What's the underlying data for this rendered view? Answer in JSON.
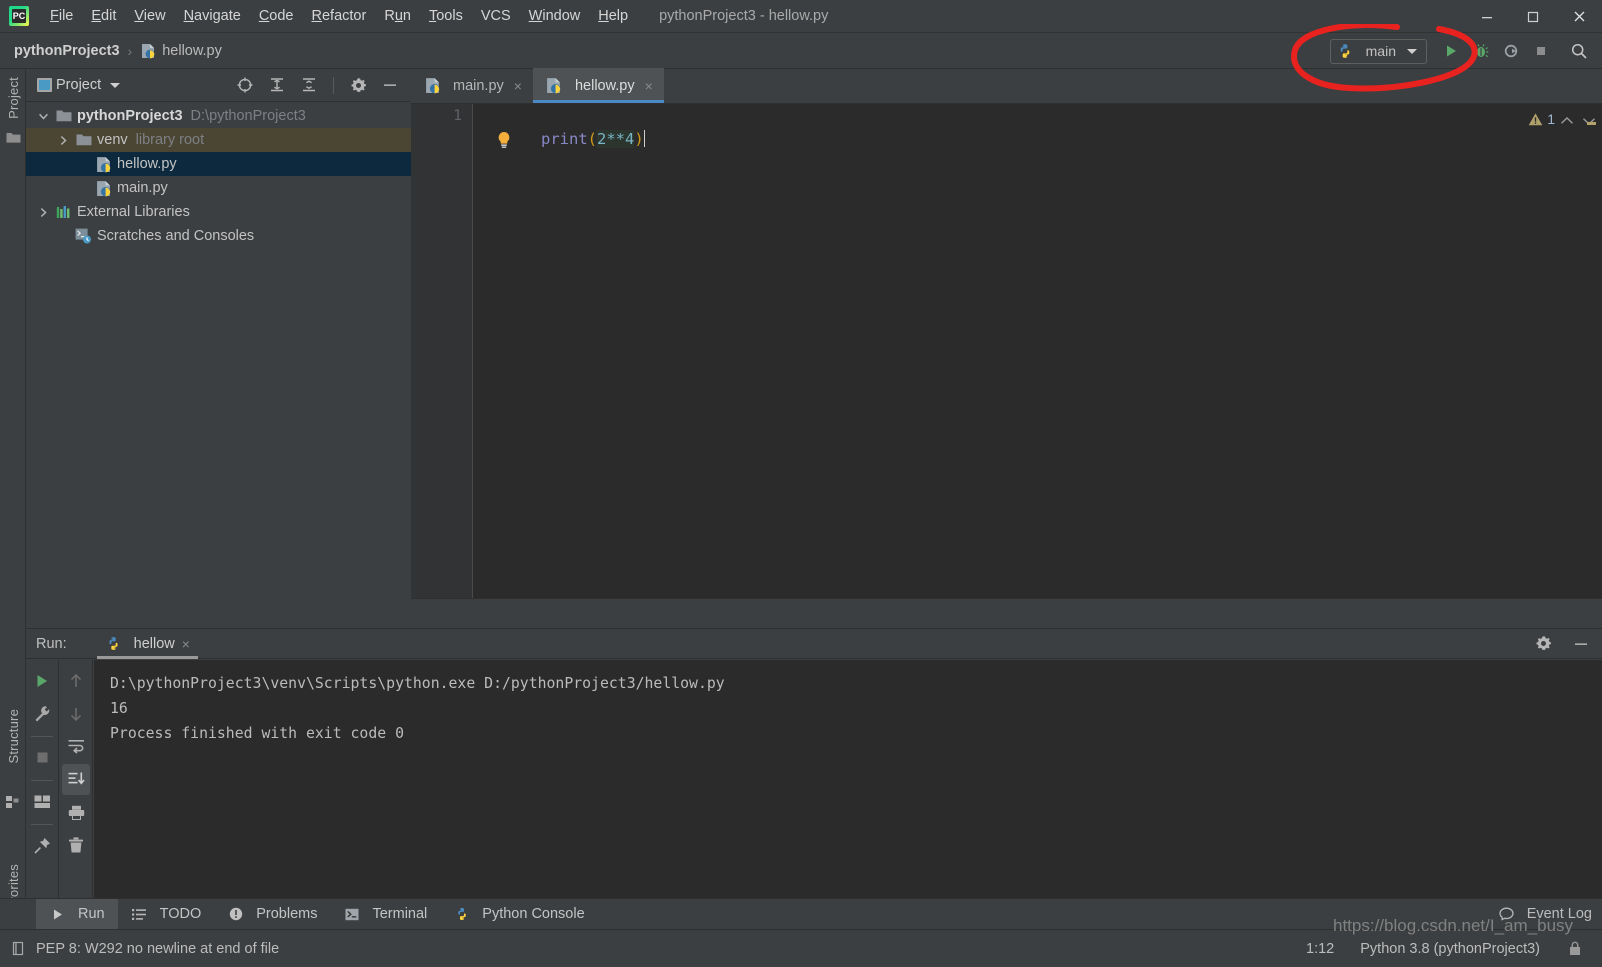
{
  "app": {
    "logo_text": "PC",
    "window_title": "pythonProject3 - hellow.py"
  },
  "menubar": {
    "items": [
      {
        "label": "File",
        "mnemonic": "F"
      },
      {
        "label": "Edit",
        "mnemonic": "E"
      },
      {
        "label": "View",
        "mnemonic": "V"
      },
      {
        "label": "Navigate",
        "mnemonic": "N"
      },
      {
        "label": "Code",
        "mnemonic": "C"
      },
      {
        "label": "Refactor",
        "mnemonic": "R"
      },
      {
        "label": "Run",
        "mnemonic": "u"
      },
      {
        "label": "Tools",
        "mnemonic": "T"
      },
      {
        "label": "VCS",
        "mnemonic": ""
      },
      {
        "label": "Window",
        "mnemonic": "W"
      },
      {
        "label": "Help",
        "mnemonic": "H"
      }
    ]
  },
  "window_controls": {
    "minimize": "minimize-icon",
    "maximize": "maximize-icon",
    "close": "close-icon"
  },
  "navbar": {
    "breadcrumb": [
      {
        "label": "pythonProject3",
        "icon": ""
      },
      {
        "label": "hellow.py",
        "icon": "python-file-icon"
      }
    ],
    "separator": "›",
    "run_config": {
      "name": "main",
      "icon": "python-icon",
      "dropdown": "chevron-down-icon"
    },
    "actions": [
      {
        "name": "run-button",
        "icon": "play-icon",
        "color": "#59a869"
      },
      {
        "name": "debug-button",
        "icon": "bug-icon",
        "color": "#59a869"
      },
      {
        "name": "run-coverage-button",
        "icon": "coverage-icon",
        "color": "#a6a6a6"
      },
      {
        "name": "stop-button",
        "icon": "stop-icon",
        "color": "#8c8c8c"
      },
      {
        "name": "search-everywhere-button",
        "icon": "search-icon",
        "color": "#c0c0c0"
      }
    ]
  },
  "annotation": {
    "shape": "hand-drawn-red-circle",
    "color": "#e8231f"
  },
  "left_strip": {
    "top_label": "Project",
    "top_icon": "folder-icon",
    "structure_label": "Structure",
    "structure_icon": "structure-icon",
    "favorites_label": "Favorites",
    "favorites_icon": "star-icon"
  },
  "project_panel": {
    "title": "Project",
    "dropdown": "chevron-down-icon",
    "toolbar": [
      {
        "name": "select-opened-file-button",
        "icon": "target-icon"
      },
      {
        "name": "expand-all-button",
        "icon": "expand-all-icon"
      },
      {
        "name": "collapse-all-button",
        "icon": "collapse-all-icon"
      },
      {
        "name": "settings-button",
        "icon": "gear-icon"
      },
      {
        "name": "hide-button",
        "icon": "minus-icon"
      }
    ],
    "tree": [
      {
        "label": "pythonProject3",
        "sub": "D:\\pythonProject3",
        "icon": "folder-icon",
        "arrow": "chevron-expanded",
        "indent": 0,
        "bold": true,
        "state": "normal"
      },
      {
        "label": "venv",
        "sub": "library root",
        "icon": "folder-icon",
        "arrow": "chevron-collapsed",
        "indent": 1,
        "bold": false,
        "state": "highlighted"
      },
      {
        "label": "hellow.py",
        "sub": "",
        "icon": "python-file-icon",
        "arrow": "none",
        "indent": 2,
        "bold": false,
        "state": "selected"
      },
      {
        "label": "main.py",
        "sub": "",
        "icon": "python-file-icon",
        "arrow": "none",
        "indent": 2,
        "bold": false,
        "state": "normal"
      },
      {
        "label": "External Libraries",
        "sub": "",
        "icon": "library-icon",
        "arrow": "chevron-collapsed",
        "indent": 0,
        "bold": false,
        "state": "normal"
      },
      {
        "label": "Scratches and Consoles",
        "sub": "",
        "icon": "scratches-icon",
        "arrow": "none",
        "indent": 1,
        "bold": false,
        "state": "normal"
      }
    ]
  },
  "editor": {
    "tabs": [
      {
        "label": "main.py",
        "icon": "python-file-icon",
        "active": false,
        "close": "×"
      },
      {
        "label": "hellow.py",
        "icon": "python-file-icon",
        "active": true,
        "close": "×"
      }
    ],
    "line_numbers": [
      "1"
    ],
    "code_tokens": [
      {
        "text": "print",
        "kind": "function"
      },
      {
        "text": "(",
        "kind": "paren"
      },
      {
        "text": "2**4",
        "kind": "number"
      },
      {
        "text": ")",
        "kind": "paren"
      }
    ],
    "code_plain": "print(2**4)",
    "intention_bulb": "lightbulb-icon",
    "inspection": {
      "icon": "warning-icon",
      "count": "1",
      "prev": "chevron-up-icon",
      "next": "chevron-down-icon"
    }
  },
  "run_panel": {
    "label": "Run:",
    "tab_name": "hellow",
    "tab_icon": "python-icon",
    "tab_close": "×",
    "header_actions": [
      {
        "name": "run-settings-button",
        "icon": "gear-icon"
      },
      {
        "name": "hide-run-panel-button",
        "icon": "minus-icon"
      }
    ],
    "toolbar_left": [
      {
        "name": "rerun-button",
        "icon": "play-icon",
        "color": "#59a869",
        "active": false
      },
      {
        "name": "edit-configuration-button",
        "icon": "wrench-icon",
        "color": "#a9a9a9",
        "active": false
      },
      {
        "name": "stop-button",
        "icon": "stop-icon",
        "color": "#8a8a8a",
        "active": false
      },
      {
        "name": "layout-settings-button",
        "icon": "layout-icon",
        "color": "#a9a9a9",
        "active": false
      },
      {
        "name": "pin-tab-button",
        "icon": "pin-icon",
        "color": "#a9a9a9",
        "active": false
      }
    ],
    "toolbar_right": [
      {
        "name": "up-the-stack-button",
        "icon": "arrow-up-icon",
        "color": "#6e6e6e",
        "active": false
      },
      {
        "name": "down-the-stack-button",
        "icon": "arrow-down-icon",
        "color": "#6e6e6e",
        "active": false
      },
      {
        "name": "soft-wrap-button",
        "icon": "soft-wrap-icon",
        "color": "#a9a9a9",
        "active": false
      },
      {
        "name": "scroll-to-end-button",
        "icon": "scroll-end-icon",
        "color": "#c8c8c8",
        "active": true
      },
      {
        "name": "print-button",
        "icon": "printer-icon",
        "color": "#a9a9a9",
        "active": false
      },
      {
        "name": "clear-all-button",
        "icon": "trash-icon",
        "color": "#a9a9a9",
        "active": false
      }
    ],
    "console_lines": [
      "D:\\pythonProject3\\venv\\Scripts\\python.exe D:/pythonProject3/hellow.py",
      "16",
      "",
      "Process finished with exit code 0"
    ]
  },
  "bottom_bar": {
    "items": [
      {
        "label": "Run",
        "icon": "play-icon",
        "active": true
      },
      {
        "label": "TODO",
        "icon": "todo-icon",
        "active": false
      },
      {
        "label": "Problems",
        "icon": "problems-icon",
        "active": false
      },
      {
        "label": "Terminal",
        "icon": "terminal-icon",
        "active": false
      },
      {
        "label": "Python Console",
        "icon": "python-icon",
        "active": false
      }
    ],
    "event_log": {
      "label": "Event Log",
      "icon": "event-log-icon"
    }
  },
  "status_bar": {
    "message": "PEP 8: W292 no newline at end of file",
    "message_icon": "inspection-icon",
    "caret_position": "1:12",
    "interpreter": "Python 3.8 (pythonProject3)",
    "lock_icon": "lock-icon"
  },
  "watermark": {
    "text": "https://blog.csdn.net/I_am_busy"
  },
  "colors": {
    "accent_blue": "#4a88c7",
    "selection": "#0d293e",
    "highlight": "#4b4533",
    "editor_bg": "#2b2b2b",
    "panel_bg": "#3c3f41",
    "green": "#59a869",
    "annotation_red": "#e8231f"
  }
}
